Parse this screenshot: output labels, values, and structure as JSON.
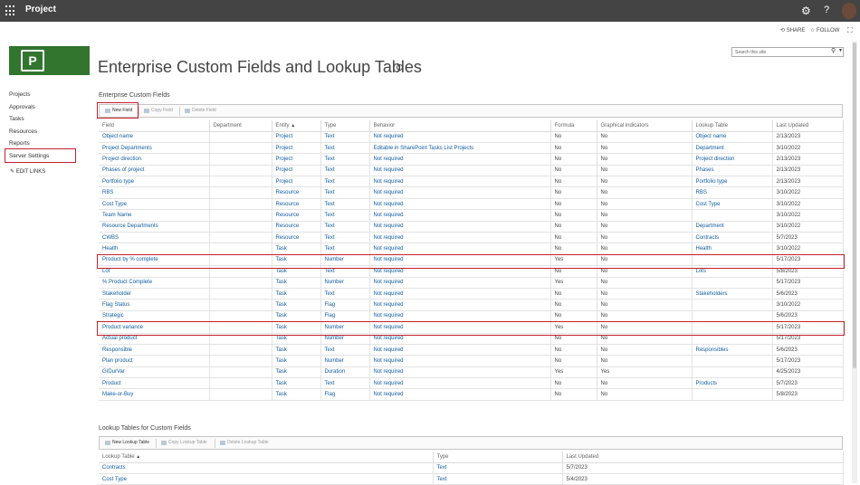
{
  "topbar": {
    "app_title": "Project"
  },
  "actions": {
    "share": "SHARE",
    "follow": "FOLLOW"
  },
  "search": {
    "placeholder": "Search this site"
  },
  "page": {
    "title": "Enterprise Custom Fields and Lookup Tables"
  },
  "nav": {
    "items": [
      "Projects",
      "Approvals",
      "Tasks",
      "Resources",
      "Reports",
      "Server Settings"
    ],
    "edit_links": "EDIT LINKS"
  },
  "ecf": {
    "section_title": "Enterprise Custom Fields",
    "toolbar": {
      "new": "New Field",
      "copy": "Copy Field",
      "delete": "Delete Field"
    },
    "columns": [
      "Field",
      "Department",
      "Entity",
      "Type",
      "Behavior",
      "Formula",
      "Graphical indicators",
      "Lookup Table",
      "Last Updated"
    ],
    "rows": [
      [
        "Object name",
        "",
        "Project",
        "Text",
        "Not required",
        "No",
        "No",
        "Object name",
        "2/13/2023"
      ],
      [
        "Project Departments",
        "",
        "Project",
        "Text",
        "Editable in SharePoint Tasks List Projects",
        "No",
        "No",
        "Department",
        "3/10/2022"
      ],
      [
        "Project direction",
        "",
        "Project",
        "Text",
        "Not required",
        "No",
        "No",
        "Project direction",
        "2/13/2023"
      ],
      [
        "Phases of project",
        "",
        "Project",
        "Text",
        "Not required",
        "No",
        "No",
        "Phases",
        "2/13/2023"
      ],
      [
        "Portfolio type",
        "",
        "Project",
        "Text",
        "Not required",
        "No",
        "No",
        "Portfolio type",
        "2/13/2023"
      ],
      [
        "RBS",
        "",
        "Resource",
        "Text",
        "Not required",
        "No",
        "No",
        "RBS",
        "3/10/2022"
      ],
      [
        "Cost Type",
        "",
        "Resource",
        "Text",
        "Not required",
        "No",
        "No",
        "Cost Type",
        "3/10/2022"
      ],
      [
        "Team Name",
        "",
        "Resource",
        "Text",
        "Not required",
        "No",
        "No",
        "",
        "3/10/2022"
      ],
      [
        "Resource Departments",
        "",
        "Resource",
        "Text",
        "Not required",
        "No",
        "No",
        "Department",
        "3/10/2022"
      ],
      [
        "CWBS",
        "",
        "Resource",
        "Text",
        "Not required",
        "No",
        "No",
        "Contracts",
        "5/7/2023"
      ],
      [
        "Health",
        "",
        "Task",
        "Text",
        "Not required",
        "No",
        "No",
        "Health",
        "3/10/2022"
      ],
      [
        "Product by % complete",
        "",
        "Task",
        "Number",
        "Not required",
        "Yes",
        "No",
        "",
        "5/17/2023"
      ],
      [
        "Lot",
        "",
        "Task",
        "Text",
        "Not required",
        "No",
        "No",
        "Lots",
        "5/8/2023"
      ],
      [
        "% Product Complete",
        "",
        "Task",
        "Number",
        "Not required",
        "Yes",
        "No",
        "",
        "5/17/2023"
      ],
      [
        "Stakeholder",
        "",
        "Task",
        "Text",
        "Not required",
        "No",
        "No",
        "Stakeholders",
        "5/6/2023"
      ],
      [
        "Flag Status",
        "",
        "Task",
        "Flag",
        "Not required",
        "No",
        "No",
        "",
        "3/10/2022"
      ],
      [
        "Strategic",
        "",
        "Task",
        "Flag",
        "Not required",
        "No",
        "No",
        "",
        "5/6/2023"
      ],
      [
        "Product variance",
        "",
        "Task",
        "Number",
        "Not required",
        "Yes",
        "No",
        "",
        "5/17/2023"
      ],
      [
        "Actual product",
        "",
        "Task",
        "Number",
        "Not required",
        "No",
        "No",
        "",
        "5/17/2023"
      ],
      [
        "Responsible",
        "",
        "Task",
        "Text",
        "Not required",
        "No",
        "No",
        "Responsibles",
        "5/6/2023"
      ],
      [
        "Plan product",
        "",
        "Task",
        "Number",
        "Not required",
        "No",
        "No",
        "",
        "5/17/2023"
      ],
      [
        "GIDurVar",
        "",
        "Task",
        "Duration",
        "Not required",
        "Yes",
        "Yes",
        "",
        "4/25/2023"
      ],
      [
        "Product",
        "",
        "Task",
        "Text",
        "Not required",
        "No",
        "No",
        "Products",
        "5/7/2023"
      ],
      [
        "Make-or-Buy",
        "",
        "Task",
        "Flag",
        "Not required",
        "No",
        "No",
        "",
        "5/8/2023"
      ]
    ]
  },
  "lookup": {
    "section_title": "Lookup Tables for Custom Fields",
    "toolbar": {
      "new": "New Lookup Table",
      "copy": "Copy Lookup Table",
      "delete": "Delete Lookup Table"
    },
    "columns": [
      "Lookup Table",
      "Type",
      "Last Updated"
    ],
    "rows": [
      [
        "Contracts",
        "Text",
        "5/7/2023"
      ],
      [
        "Cost Type",
        "Text",
        "5/4/2023"
      ]
    ]
  }
}
